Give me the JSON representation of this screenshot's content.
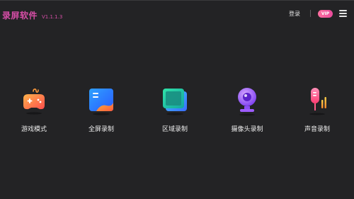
{
  "app": {
    "title": "录屏软件",
    "version": "V1.1.1.3"
  },
  "header": {
    "login_label": "登录",
    "vip_label": "VIP"
  },
  "tiles": [
    {
      "label": "游戏模式",
      "icon": "gamepad-icon"
    },
    {
      "label": "全屏录制",
      "icon": "fullscreen-icon"
    },
    {
      "label": "区域录制",
      "icon": "region-icon"
    },
    {
      "label": "摄像头录制",
      "icon": "camera-icon"
    },
    {
      "label": "声音录制",
      "icon": "microphone-icon"
    }
  ],
  "colors": {
    "accent": "#d84ea8",
    "background": "#232325"
  }
}
